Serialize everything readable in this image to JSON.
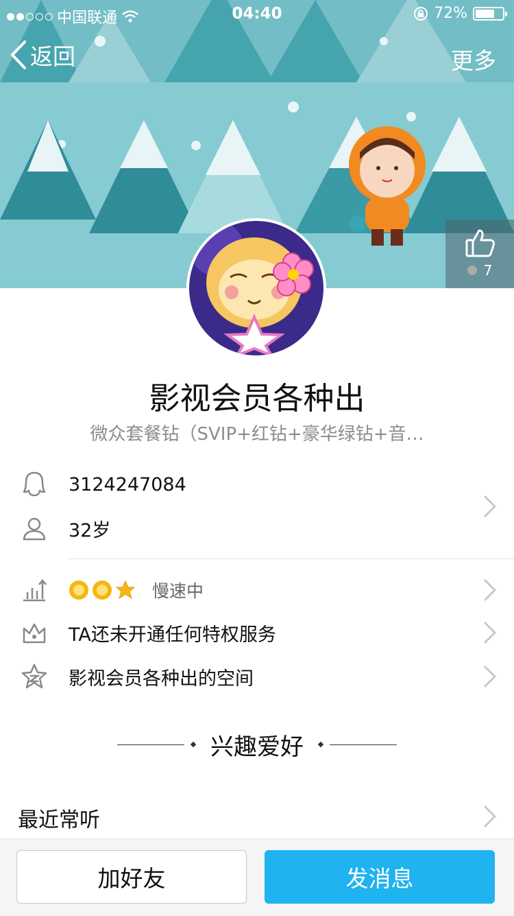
{
  "status_bar": {
    "carrier": "中国联通",
    "time": "04:40",
    "battery": "72%",
    "signal_bars_filled": 2,
    "signal_bars_total": 5,
    "battery_level": 0.72
  },
  "nav": {
    "back_label": "返回",
    "more_label": "更多"
  },
  "like": {
    "count": "7"
  },
  "profile": {
    "name": "影视会员各种出",
    "signature": "微众套餐钻（SVIP+红钻+豪华绿钻+音…"
  },
  "info": {
    "qq_number": "3124247084",
    "age": "32岁"
  },
  "level": {
    "status": "慢速中",
    "icons": [
      "sun-icon",
      "sun-icon",
      "star-icon"
    ]
  },
  "privilege": {
    "label": "TA还未开通任何特权服务"
  },
  "space": {
    "label": "影视会员各种出的空间"
  },
  "interests": {
    "title": "兴趣爱好",
    "recent_label": "最近常听"
  },
  "actions": {
    "add_friend": "加好友",
    "send_message": "发消息"
  },
  "colors": {
    "banner_sky": "#86cbd2",
    "primary_button": "#1fb3f0",
    "tree_dark": "#3a9aa6",
    "tree_light": "#a8dbe0"
  }
}
